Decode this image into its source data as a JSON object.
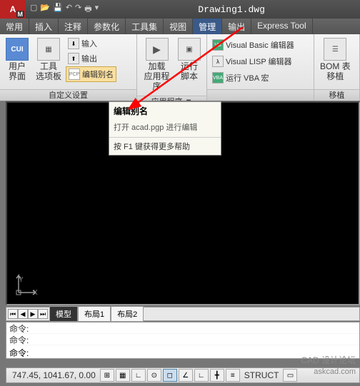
{
  "title": "Drawing1.dwg",
  "app_logo": "A",
  "app_logo_sub": "M",
  "tabs": [
    "常用",
    "插入",
    "注释",
    "参数化",
    "工具集",
    "视图",
    "管理",
    "输出",
    "Express Tool"
  ],
  "active_tab_index": 6,
  "ribbon": {
    "panel1": {
      "title": "自定义设置",
      "btn_ui": {
        "icon": "CUI",
        "l1": "用户",
        "l2": "界面"
      },
      "btn_tools": {
        "l1": "工具",
        "l2": "选项板"
      },
      "btn_import": {
        "label": "输入"
      },
      "btn_export": {
        "label": "输出"
      },
      "btn_editalias": {
        "label": "编辑别名"
      }
    },
    "panel2": {
      "title": "应用程序 ▼",
      "btn_load": {
        "l1": "加载",
        "l2": "应用程序"
      },
      "btn_run": {
        "l1": "运行",
        "l2": "脚本"
      }
    },
    "panel3": {
      "btn_vb": {
        "label": "Visual Basic 编辑器"
      },
      "btn_vlisp": {
        "label": "Visual LISP 编辑器"
      },
      "btn_vba": {
        "label": "运行 VBA 宏"
      }
    },
    "panel4": {
      "title": "移植",
      "btn_bom": {
        "l1": "BOM 表",
        "l2": "移植"
      }
    }
  },
  "tooltip": {
    "title": "编辑别名",
    "desc": "打开 acad.pgp 进行编辑",
    "help": "按 F1 键获得更多帮助"
  },
  "ucs": {
    "x": "X",
    "y": "Y"
  },
  "layout": {
    "tabs": [
      "模型",
      "布局1",
      "布局2"
    ],
    "active": 0
  },
  "cmd": {
    "prompt": "命令:",
    "history": [
      "命令:",
      "命令:"
    ]
  },
  "status": {
    "coords": "747.45, 1041.67, 0.00",
    "struct": "STRUCT"
  },
  "watermark": {
    "l1": "CAD 设计论坛",
    "l2": "askcad.com"
  }
}
